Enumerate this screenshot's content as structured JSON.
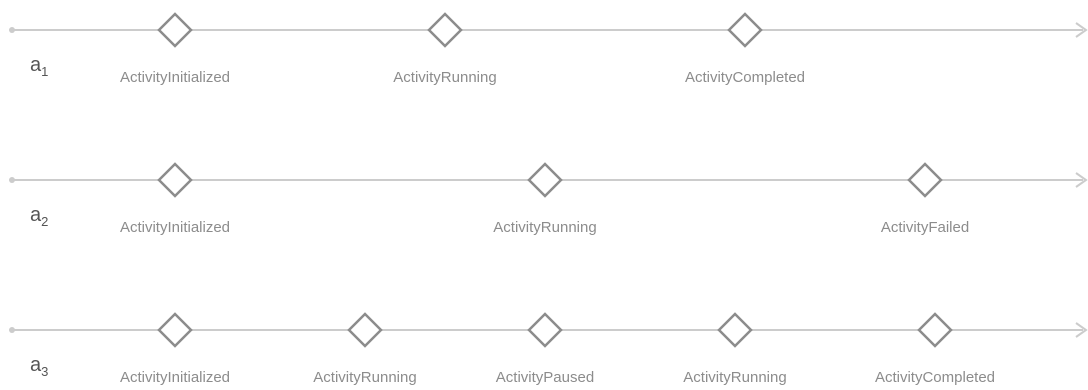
{
  "timelines": [
    {
      "label": "a",
      "subscript": "1",
      "events": [
        {
          "name": "ActivityInitialized"
        },
        {
          "name": "ActivityRunning"
        },
        {
          "name": "ActivityCompleted"
        }
      ]
    },
    {
      "label": "a",
      "subscript": "2",
      "events": [
        {
          "name": "ActivityInitialized"
        },
        {
          "name": "ActivityRunning"
        },
        {
          "name": "ActivityFailed"
        }
      ]
    },
    {
      "label": "a",
      "subscript": "3",
      "events": [
        {
          "name": "ActivityInitialized"
        },
        {
          "name": "ActivityRunning"
        },
        {
          "name": "ActivityPaused"
        },
        {
          "name": "ActivityRunning"
        },
        {
          "name": "ActivityCompleted"
        }
      ]
    }
  ],
  "colors": {
    "line": "#cccccc",
    "diamond": "#8c8c8c",
    "event_text": "#8c8c8c",
    "label_text": "#555555",
    "start_dot": "#cccccc"
  }
}
